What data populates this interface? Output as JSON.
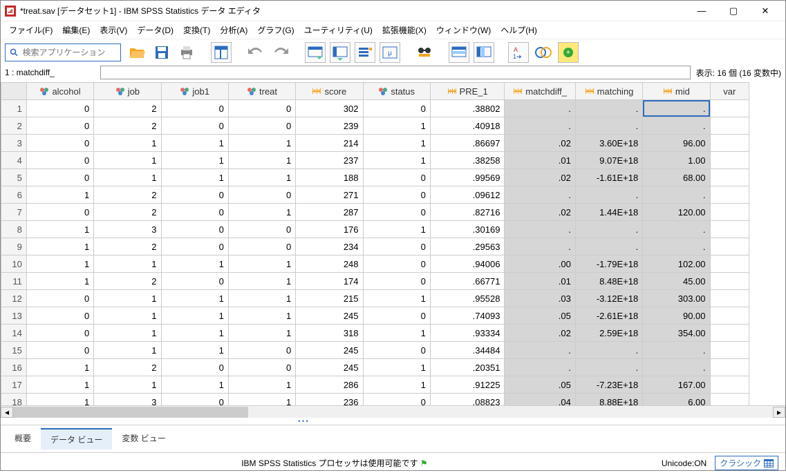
{
  "window": {
    "title": "*treat.sav [データセット1] - IBM SPSS Statistics データ エディタ"
  },
  "menu": {
    "file": "ファイル(F)",
    "edit": "編集(E)",
    "view": "表示(V)",
    "data": "データ(D)",
    "transform": "変換(T)",
    "analyze": "分析(A)",
    "graphs": "グラフ(G)",
    "utility": "ユーティリティ(U)",
    "ext": "拡張機能(X)",
    "window": "ウィンドウ(W)",
    "help": "ヘルプ(H)"
  },
  "search": {
    "placeholder": "検索アプリケーション"
  },
  "cellref": {
    "label": "1 : matchdiff_",
    "value": ""
  },
  "varcount": "表示: 16 個 (16 変数中)",
  "tabs": {
    "overview": "概要",
    "dataview": "データ ビュー",
    "varview": "変数 ビュー"
  },
  "status": {
    "processor": "IBM SPSS Statistics プロセッサは使用可能です",
    "unicode": "Unicode:ON",
    "classic": "クラシック"
  },
  "columns": [
    {
      "name": "alcohol",
      "type": "nominal"
    },
    {
      "name": "job",
      "type": "nominal"
    },
    {
      "name": "job1",
      "type": "nominal"
    },
    {
      "name": "treat",
      "type": "nominal"
    },
    {
      "name": "score",
      "type": "scale"
    },
    {
      "name": "status",
      "type": "nominal"
    },
    {
      "name": "PRE_1",
      "type": "scale"
    },
    {
      "name": "matchdiff_",
      "type": "scale",
      "shaded": true
    },
    {
      "name": "matching",
      "type": "scale",
      "shaded": true
    },
    {
      "name": "mid",
      "type": "scale",
      "shaded": true
    },
    {
      "name": "var",
      "type": "empty"
    }
  ],
  "rows": [
    {
      "n": 1,
      "alcohol": "0",
      "job": "2",
      "job1": "0",
      "treat": "0",
      "score": "302",
      "status": "0",
      "PRE_1": ".38802",
      "matchdiff_": ".",
      "matching": ".",
      "mid": "."
    },
    {
      "n": 2,
      "alcohol": "0",
      "job": "2",
      "job1": "0",
      "treat": "0",
      "score": "239",
      "status": "1",
      "PRE_1": ".40918",
      "matchdiff_": ".",
      "matching": ".",
      "mid": "."
    },
    {
      "n": 3,
      "alcohol": "0",
      "job": "1",
      "job1": "1",
      "treat": "1",
      "score": "214",
      "status": "1",
      "PRE_1": ".86697",
      "matchdiff_": ".02",
      "matching": "3.60E+18",
      "mid": "96.00"
    },
    {
      "n": 4,
      "alcohol": "0",
      "job": "1",
      "job1": "1",
      "treat": "1",
      "score": "237",
      "status": "1",
      "PRE_1": ".38258",
      "matchdiff_": ".01",
      "matching": "9.07E+18",
      "mid": "1.00"
    },
    {
      "n": 5,
      "alcohol": "0",
      "job": "1",
      "job1": "1",
      "treat": "1",
      "score": "188",
      "status": "0",
      "PRE_1": ".99569",
      "matchdiff_": ".02",
      "matching": "-1.61E+18",
      "mid": "68.00"
    },
    {
      "n": 6,
      "alcohol": "1",
      "job": "2",
      "job1": "0",
      "treat": "0",
      "score": "271",
      "status": "0",
      "PRE_1": ".09612",
      "matchdiff_": ".",
      "matching": ".",
      "mid": "."
    },
    {
      "n": 7,
      "alcohol": "0",
      "job": "2",
      "job1": "0",
      "treat": "1",
      "score": "287",
      "status": "0",
      "PRE_1": ".82716",
      "matchdiff_": ".02",
      "matching": "1.44E+18",
      "mid": "120.00"
    },
    {
      "n": 8,
      "alcohol": "1",
      "job": "3",
      "job1": "0",
      "treat": "0",
      "score": "176",
      "status": "1",
      "PRE_1": ".30169",
      "matchdiff_": ".",
      "matching": ".",
      "mid": "."
    },
    {
      "n": 9,
      "alcohol": "1",
      "job": "2",
      "job1": "0",
      "treat": "0",
      "score": "234",
      "status": "0",
      "PRE_1": ".29563",
      "matchdiff_": ".",
      "matching": ".",
      "mid": "."
    },
    {
      "n": 10,
      "alcohol": "1",
      "job": "1",
      "job1": "1",
      "treat": "1",
      "score": "248",
      "status": "0",
      "PRE_1": ".94006",
      "matchdiff_": ".00",
      "matching": "-1.79E+18",
      "mid": "102.00"
    },
    {
      "n": 11,
      "alcohol": "1",
      "job": "2",
      "job1": "0",
      "treat": "1",
      "score": "174",
      "status": "0",
      "PRE_1": ".66771",
      "matchdiff_": ".01",
      "matching": "8.48E+18",
      "mid": "45.00"
    },
    {
      "n": 12,
      "alcohol": "0",
      "job": "1",
      "job1": "1",
      "treat": "1",
      "score": "215",
      "status": "1",
      "PRE_1": ".95528",
      "matchdiff_": ".03",
      "matching": "-3.12E+18",
      "mid": "303.00"
    },
    {
      "n": 13,
      "alcohol": "0",
      "job": "1",
      "job1": "1",
      "treat": "1",
      "score": "245",
      "status": "0",
      "PRE_1": ".74093",
      "matchdiff_": ".05",
      "matching": "-2.61E+18",
      "mid": "90.00"
    },
    {
      "n": 14,
      "alcohol": "0",
      "job": "1",
      "job1": "1",
      "treat": "1",
      "score": "318",
      "status": "1",
      "PRE_1": ".93334",
      "matchdiff_": ".02",
      "matching": "2.59E+18",
      "mid": "354.00"
    },
    {
      "n": 15,
      "alcohol": "0",
      "job": "1",
      "job1": "1",
      "treat": "0",
      "score": "245",
      "status": "0",
      "PRE_1": ".34484",
      "matchdiff_": ".",
      "matching": ".",
      "mid": "."
    },
    {
      "n": 16,
      "alcohol": "1",
      "job": "2",
      "job1": "0",
      "treat": "0",
      "score": "245",
      "status": "1",
      "PRE_1": ".20351",
      "matchdiff_": ".",
      "matching": ".",
      "mid": "."
    },
    {
      "n": 17,
      "alcohol": "1",
      "job": "1",
      "job1": "1",
      "treat": "1",
      "score": "286",
      "status": "1",
      "PRE_1": ".91225",
      "matchdiff_": ".05",
      "matching": "-7.23E+18",
      "mid": "167.00"
    },
    {
      "n": 18,
      "alcohol": "1",
      "job": "3",
      "job1": "0",
      "treat": "1",
      "score": "236",
      "status": "0",
      "PRE_1": ".08823",
      "matchdiff_": ".04",
      "matching": "8.88E+18",
      "mid": "6.00"
    }
  ],
  "selected": {
    "row": 1,
    "col": "mid"
  }
}
